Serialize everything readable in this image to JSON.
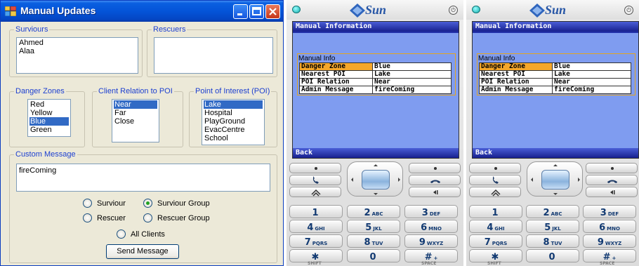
{
  "window": {
    "title": "Manual Updates",
    "survivors": {
      "label": "Surviours",
      "items": [
        "Ahmed",
        "Alaa"
      ]
    },
    "rescuers": {
      "label": "Rescuers",
      "items": []
    },
    "danger_zones": {
      "label": "Danger Zones",
      "items": [
        "Red",
        "Yellow",
        "Blue",
        "Green"
      ],
      "selected": "Blue"
    },
    "client_relation": {
      "label": "Client Relation to POI",
      "items": [
        "Near",
        "Far",
        "Close"
      ],
      "selected": "Near"
    },
    "poi": {
      "label": "Point of Interest (POI)",
      "items": [
        "Lake",
        "Hospital",
        "PlayGround",
        "EvacCentre",
        "School"
      ],
      "selected": "Lake"
    },
    "custom_message": {
      "label": "Custom Message",
      "value": "fireComing"
    },
    "radios": [
      {
        "label": "Surviour",
        "checked": false
      },
      {
        "label": "Surviour Group",
        "checked": true
      },
      {
        "label": "Rescuer",
        "checked": false
      },
      {
        "label": "Rescuer Group",
        "checked": false
      },
      {
        "label": "All Clients",
        "checked": false
      }
    ],
    "send_button": "Send Message"
  },
  "phone": {
    "brand": "Sun",
    "title": "Manual Information",
    "info_label": "Manual Info",
    "rows": [
      {
        "key": "Danger Zone",
        "value": "Blue"
      },
      {
        "key": "Nearest POI",
        "value": "Lake"
      },
      {
        "key": "POI Relation",
        "value": "Near"
      },
      {
        "key": "Admin Message",
        "value": "fireComing"
      }
    ],
    "softkey_left": "Back",
    "keys": [
      {
        "digit": "1",
        "letters": ""
      },
      {
        "digit": "2",
        "letters": "ABC"
      },
      {
        "digit": "3",
        "letters": "DEF"
      },
      {
        "digit": "4",
        "letters": "GHI"
      },
      {
        "digit": "5",
        "letters": "JKL"
      },
      {
        "digit": "6",
        "letters": "MNO"
      },
      {
        "digit": "7",
        "letters": "PQRS"
      },
      {
        "digit": "8",
        "letters": "TUV"
      },
      {
        "digit": "9",
        "letters": "WXYZ"
      },
      {
        "digit": "✱",
        "letters": ""
      },
      {
        "digit": "0",
        "letters": ""
      },
      {
        "digit": "#",
        "letters": "+"
      }
    ],
    "shift_label": "SHIFT",
    "space_label": "SPACE",
    "icons": [
      "led-icon",
      "power-icon",
      "send-call-icon",
      "end-call-icon",
      "home-icon",
      "back-icon"
    ]
  }
}
